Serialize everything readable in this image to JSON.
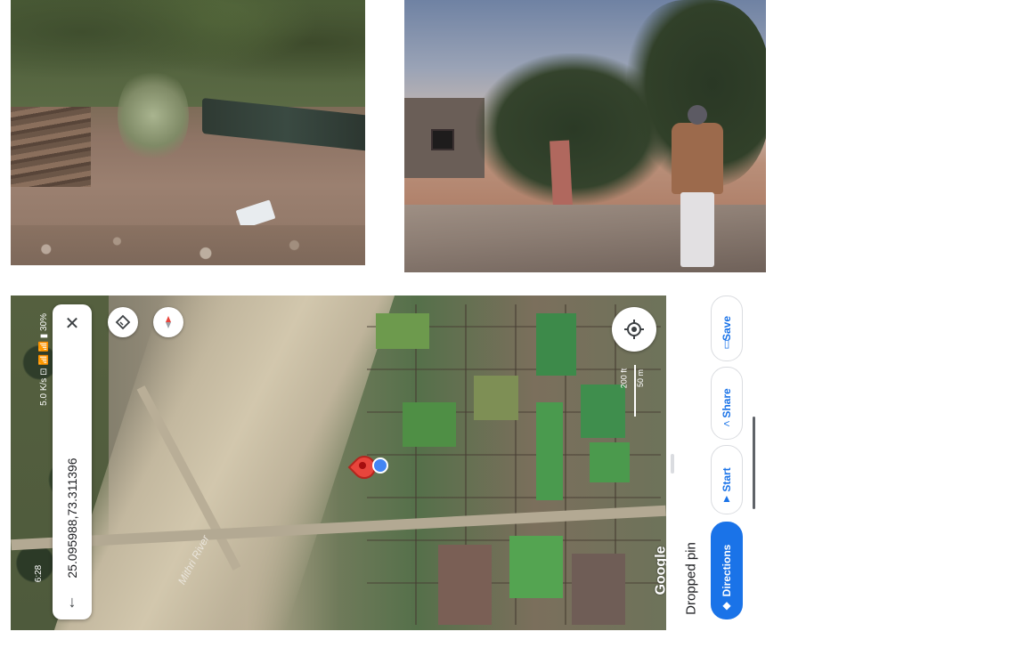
{
  "map": {
    "coordinates": "25.095988,73.311396",
    "status_bar": "5.0 K/s ⊡ 📶 📶 ▮ 30%",
    "time": "6:28",
    "scale_feet": "200 ft",
    "scale_meters": "50 m",
    "river_label": "Mithri River",
    "logo": "Google"
  },
  "sheet": {
    "title": "Dropped pin",
    "actions": {
      "directions": "Directions",
      "start": "Start",
      "share": "Share",
      "save": "Save"
    }
  },
  "icons": {
    "close": "close-icon",
    "back": "arrow-down-icon",
    "layers": "layers-icon",
    "compass": "compass-icon",
    "location": "my-location-icon"
  },
  "colors": {
    "accent": "#1a73e8",
    "pin": "#e8453c",
    "location_dot": "#4285f4"
  }
}
